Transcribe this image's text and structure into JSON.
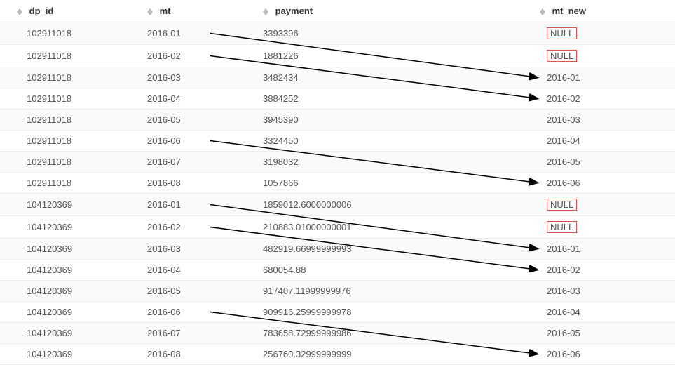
{
  "columns": {
    "dp_id": "dp_id",
    "mt": "mt",
    "payment": "payment",
    "mt_new": "mt_new"
  },
  "null_label": "NULL",
  "rows": [
    {
      "dp_id": "102911018",
      "mt": "2016-01",
      "payment": "3393396",
      "mt_new": "NULL"
    },
    {
      "dp_id": "102911018",
      "mt": "2016-02",
      "payment": "1881226",
      "mt_new": "NULL"
    },
    {
      "dp_id": "102911018",
      "mt": "2016-03",
      "payment": "3482434",
      "mt_new": "2016-01"
    },
    {
      "dp_id": "102911018",
      "mt": "2016-04",
      "payment": "3884252",
      "mt_new": "2016-02"
    },
    {
      "dp_id": "102911018",
      "mt": "2016-05",
      "payment": "3945390",
      "mt_new": "2016-03"
    },
    {
      "dp_id": "102911018",
      "mt": "2016-06",
      "payment": "3324450",
      "mt_new": "2016-04"
    },
    {
      "dp_id": "102911018",
      "mt": "2016-07",
      "payment": "3198032",
      "mt_new": "2016-05"
    },
    {
      "dp_id": "102911018",
      "mt": "2016-08",
      "payment": "1057866",
      "mt_new": "2016-06"
    },
    {
      "dp_id": "104120369",
      "mt": "2016-01",
      "payment": "1859012.6000000006",
      "mt_new": "NULL"
    },
    {
      "dp_id": "104120369",
      "mt": "2016-02",
      "payment": "210883.01000000001",
      "mt_new": "NULL"
    },
    {
      "dp_id": "104120369",
      "mt": "2016-03",
      "payment": "482919.66999999993",
      "mt_new": "2016-01"
    },
    {
      "dp_id": "104120369",
      "mt": "2016-04",
      "payment": "680054.88",
      "mt_new": "2016-02"
    },
    {
      "dp_id": "104120369",
      "mt": "2016-05",
      "payment": "917407.11999999976",
      "mt_new": "2016-03"
    },
    {
      "dp_id": "104120369",
      "mt": "2016-06",
      "payment": "909916.25999999978",
      "mt_new": "2016-04"
    },
    {
      "dp_id": "104120369",
      "mt": "2016-07",
      "payment": "783658.72999999986",
      "mt_new": "2016-05"
    },
    {
      "dp_id": "104120369",
      "mt": "2016-08",
      "payment": "256760.32999999999",
      "mt_new": "2016-06"
    }
  ],
  "arrows": [
    {
      "from_row": 0,
      "to_row": 2
    },
    {
      "from_row": 1,
      "to_row": 3
    },
    {
      "from_row": 5,
      "to_row": 7
    },
    {
      "from_row": 8,
      "to_row": 10
    },
    {
      "from_row": 9,
      "to_row": 11
    },
    {
      "from_row": 13,
      "to_row": 15
    }
  ]
}
